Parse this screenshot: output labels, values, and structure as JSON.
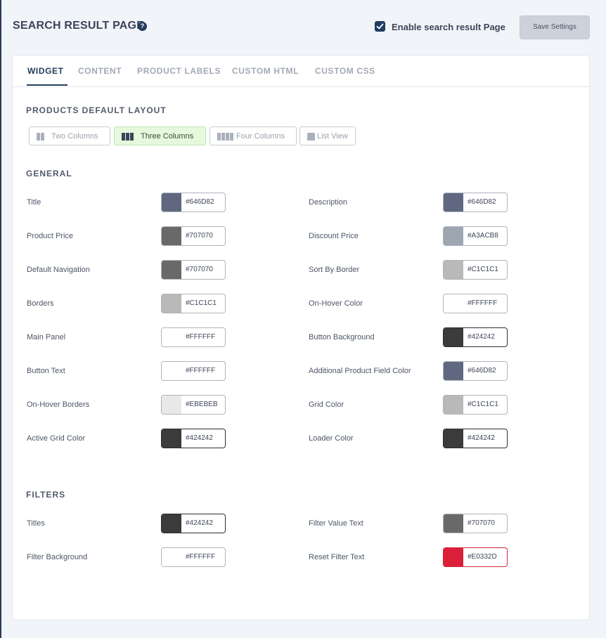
{
  "header": {
    "title": "SEARCH RESULT PAGE",
    "help_icon": "question-circle-icon",
    "enable_label": "Enable search result Page",
    "enable_checked": true,
    "save_label": "Save Settings"
  },
  "tabs": [
    {
      "label": "WIDGET",
      "active": true
    },
    {
      "label": "CONTENT",
      "active": false
    },
    {
      "label": "PRODUCT LABELS",
      "active": false
    },
    {
      "label": "CUSTOM HTML",
      "active": false
    },
    {
      "label": "CUSTOM CSS",
      "active": false
    }
  ],
  "layout": {
    "heading": "PRODUCTS DEFAULT LAYOUT",
    "options": [
      {
        "label": "Two Columns",
        "icon": "two-columns-icon",
        "active": false
      },
      {
        "label": "Three Columns",
        "icon": "three-columns-icon",
        "active": true
      },
      {
        "label": "Four Columns",
        "icon": "four-columns-icon",
        "active": false
      },
      {
        "label": "List View",
        "icon": "list-view-icon",
        "active": false
      }
    ]
  },
  "general": {
    "heading": "GENERAL",
    "rows": [
      {
        "left": {
          "label": "Title",
          "color": "#646D82"
        },
        "right": {
          "label": "Description",
          "color": "#646D82"
        }
      },
      {
        "left": {
          "label": "Product Price",
          "color": "#707070"
        },
        "right": {
          "label": "Discount Price",
          "color": "#A3ACB8"
        }
      },
      {
        "left": {
          "label": "Default Navigation",
          "color": "#707070"
        },
        "right": {
          "label": "Sort By Border",
          "color": "#C1C1C1"
        }
      },
      {
        "left": {
          "label": "Borders",
          "color": "#C1C1C1"
        },
        "right": {
          "label": "On-Hover Color",
          "color": "#FFFFFF"
        }
      },
      {
        "left": {
          "label": "Main Panel",
          "color": "#FFFFFF"
        },
        "right": {
          "label": "Button Background",
          "color": "#424242"
        }
      },
      {
        "left": {
          "label": "Button Text",
          "color": "#FFFFFF"
        },
        "right": {
          "label": "Additional Product Field Color",
          "color": "#646D82"
        }
      },
      {
        "left": {
          "label": "On-Hover Borders",
          "color": "#EBEBEB"
        },
        "right": {
          "label": "Grid Color",
          "color": "#C1C1C1"
        }
      },
      {
        "left": {
          "label": "Active Grid Color",
          "color": "#424242"
        },
        "right": {
          "label": "Loader Color",
          "color": "#424242"
        }
      }
    ]
  },
  "filters": {
    "heading": "FILTERS",
    "rows": [
      {
        "left": {
          "label": "Titles",
          "color": "#424242"
        },
        "right": {
          "label": "Filter Value Text",
          "color": "#707070"
        }
      },
      {
        "left": {
          "label": "Filter Background",
          "color": "#FFFFFF"
        },
        "right": {
          "label": "Reset Filter Text",
          "color": "#E0332D"
        }
      }
    ]
  },
  "swatch_chip_colors": {
    "#646D82": "#5f6880",
    "#707070": "#696969",
    "#A3ACB8": "#9ea6b1",
    "#C1C1C1": "#b9b9b9",
    "#FFFFFF": "#ffffff",
    "#424242": "#3b3b3b",
    "#EBEBEB": "#e8e8e8",
    "#E0332D": "#dc1f38"
  }
}
